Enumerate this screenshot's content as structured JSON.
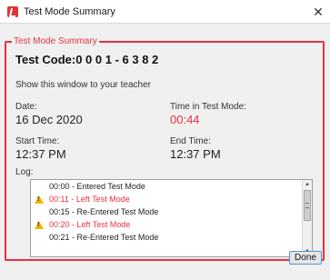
{
  "window": {
    "title": "Test Mode Summary",
    "close_label": "✕"
  },
  "summary": {
    "legend": "Test Mode Summary",
    "test_code": "Test Code:0 0 0 1 - 6 3 8 2",
    "instruction": "Show this window to your teacher",
    "date_label": "Date:",
    "date_value": "16 Dec 2020",
    "time_label": "Time in Test Mode:",
    "time_value": "00:44",
    "start_label": "Start Time:",
    "start_value": "12:37 PM",
    "end_label": "End Time:",
    "end_value": "12:37 PM",
    "log_label": "Log:"
  },
  "log": {
    "items": [
      {
        "text": "00:00 - Entered Test Mode",
        "warning": false
      },
      {
        "text": "00:11 - Left Test Mode",
        "warning": true
      },
      {
        "text": "00:15 - Re-Entered Test Mode",
        "warning": false
      },
      {
        "text": "00:20 - Left Test Mode",
        "warning": true
      },
      {
        "text": "00:21 - Re-Entered Test Mode",
        "warning": false
      }
    ]
  },
  "buttons": {
    "done": "Done"
  },
  "colors": {
    "accent_red": "#e8313d",
    "warning_yellow": "#f0b400",
    "focus_blue": "#4f95d9"
  },
  "icons": {
    "app": "test-mode-icon",
    "warning": "warning-icon",
    "close": "close-icon"
  }
}
